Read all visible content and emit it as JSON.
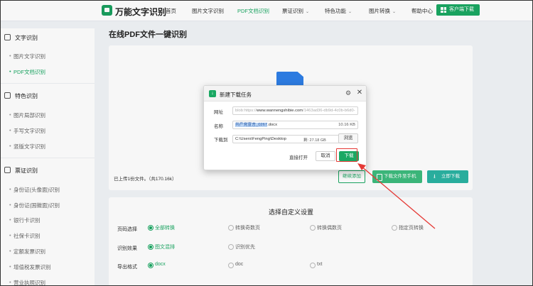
{
  "nav": {
    "brand": "万能文字识别",
    "items": [
      {
        "label": "首页",
        "active": false,
        "caret": false
      },
      {
        "label": "图片文字识别",
        "active": false,
        "caret": false
      },
      {
        "label": "PDF文档识别",
        "active": true,
        "caret": false
      },
      {
        "label": "票证识别",
        "active": false,
        "caret": true
      },
      {
        "label": "特色功能",
        "active": false,
        "caret": true
      },
      {
        "label": "图片转换",
        "active": false,
        "caret": true
      },
      {
        "label": "帮助中心",
        "active": false,
        "caret": false
      }
    ],
    "download_btn": "客户端下载"
  },
  "sidebar": {
    "sections": [
      {
        "title": "文字识别",
        "items": [
          {
            "label": "图片文字识别",
            "active": false
          },
          {
            "label": "PDF文档识别",
            "active": true
          }
        ]
      },
      {
        "title": "特色识别",
        "items": [
          {
            "label": "图片局部识别"
          },
          {
            "label": "手写文字识别"
          },
          {
            "label": "竖版文字识别"
          }
        ]
      },
      {
        "title": "票证识别",
        "items": [
          {
            "label": "身份证(头像面)识别"
          },
          {
            "label": "身份证(国徽面)识别"
          },
          {
            "label": "银行卡识别"
          },
          {
            "label": "社保卡识别"
          },
          {
            "label": "定额发票识别"
          },
          {
            "label": "增值税发票识别"
          },
          {
            "label": "营业执照识别"
          }
        ]
      }
    ]
  },
  "main": {
    "title": "在线PDF文件一键识别",
    "upload_info": "已上传1份文件。（共170.16k）",
    "continue_btn": "继续添加",
    "phone_btn": "下载文件至手机",
    "now_btn": "立即下载"
  },
  "settings": {
    "title": "选择自定义设置",
    "rows": [
      {
        "label": "页码选择",
        "options": [
          "全部转换",
          "转换奇数页",
          "转换偶数页",
          "指定页转换"
        ],
        "selected": 0
      },
      {
        "label": "识别效果",
        "options": [
          "图文混排",
          "识别优先"
        ],
        "selected": 0
      },
      {
        "label": "导出格式",
        "options": [
          "docx",
          "doc",
          "txt"
        ],
        "selected": 0
      }
    ]
  },
  "dialog": {
    "title": "新建下载任务",
    "url_label": "网址",
    "url_prefix": "blob:https://",
    "url_domain": "www.wannengshibie.com",
    "url_suffix": "/1463ad36-db9d-4c0b-b6d0-",
    "name_label": "名称",
    "name_value": "共产党宣言_0267",
    "name_ext": ".docx",
    "file_size": "10.16 KB",
    "saveto_label": "下载到",
    "path": "C:\\Users\\FengPing\\Desktop",
    "drive_space": "剩: 27.18 GB",
    "browse_btn": "浏览",
    "direct_open": "直接打开",
    "cancel_btn": "取消",
    "download_btn": "下载"
  },
  "accent_color": "#1aa863",
  "annotation_color": "#e53935"
}
